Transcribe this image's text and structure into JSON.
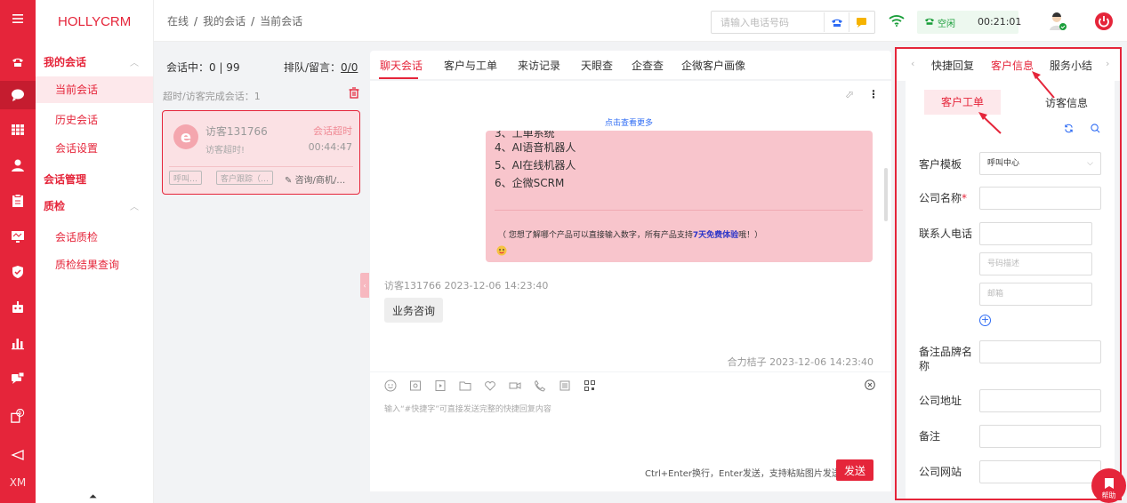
{
  "brand": "HOLLYCRM",
  "rail": {
    "footer": "XM",
    "badge": "5"
  },
  "nav": {
    "group1": "我的会话",
    "item_current": "当前会话",
    "item_history": "历史会话",
    "item_settings": "会话设置",
    "group2": "会话管理",
    "group3": "质检",
    "item_qc": "会话质检",
    "item_qc_result": "质检结果查询"
  },
  "topbar": {
    "crumb1": "在线",
    "crumb2": "我的会话",
    "crumb3": "当前会话",
    "phone_placeholder": "请输入电话号码",
    "status": "空闲",
    "timer": "00:21:01"
  },
  "session": {
    "count": "会话中：0 | 99",
    "queue_label": "排队/留言：",
    "queue_value": "0/0",
    "timeout": "超时/访客完成会话：1",
    "card": {
      "name": "访客131766",
      "status": "会话超时",
      "sub": "访客超时!",
      "time": "00:44:47",
      "chip1": "呼叫…",
      "chip2": "客户跟踪（…",
      "consult": "咨询/商机/…"
    }
  },
  "chat": {
    "tabs": [
      "聊天会话",
      "客户与工单",
      "来访记录",
      "天眼查",
      "企查查",
      "企微客户画像"
    ],
    "more": "点击查看更多",
    "lines": [
      "3、工单系统",
      "4、AI语音机器人",
      "5、AI在线机器人",
      "6、企微SCRM"
    ],
    "note_prefix": "（ 您想了解哪个产品可以直接输入数字，所有产品支持",
    "note_bold": "7天免费体验",
    "note_suffix": "哦！）",
    "visitor_meta": "访客131766 2023-12-06 14:23:40",
    "visitor_msg": "业务咨询",
    "agent_meta": "合力桔子 2023-12-06 14:23:40",
    "compose_placeholder": "输入“#快捷字”可直接发送完整的快捷回复内容",
    "send_hint": "Ctrl+Enter换行，Enter发送，支持粘贴图片发送",
    "send_label": "发送"
  },
  "right": {
    "tabs": [
      "快捷回复",
      "客户信息",
      "服务小结"
    ],
    "sub_tabs": [
      "客户工单",
      "访客信息"
    ],
    "fields": {
      "template_label": "客户模板",
      "template_value": "呼叫中心",
      "company_label": "公司名称",
      "required_mark": "*",
      "phone_label": "联系人电话",
      "phone_desc_placeholder": "号码描述",
      "email_placeholder": "邮箱",
      "brand_label": "备注品牌名称",
      "address_label": "公司地址",
      "remark_label": "备注",
      "website_label": "公司网站"
    }
  },
  "fab_label": "帮助",
  "colors": {
    "accent": "#e5253a",
    "link": "#2f6cf4",
    "bubble": "#f8c5cc"
  }
}
